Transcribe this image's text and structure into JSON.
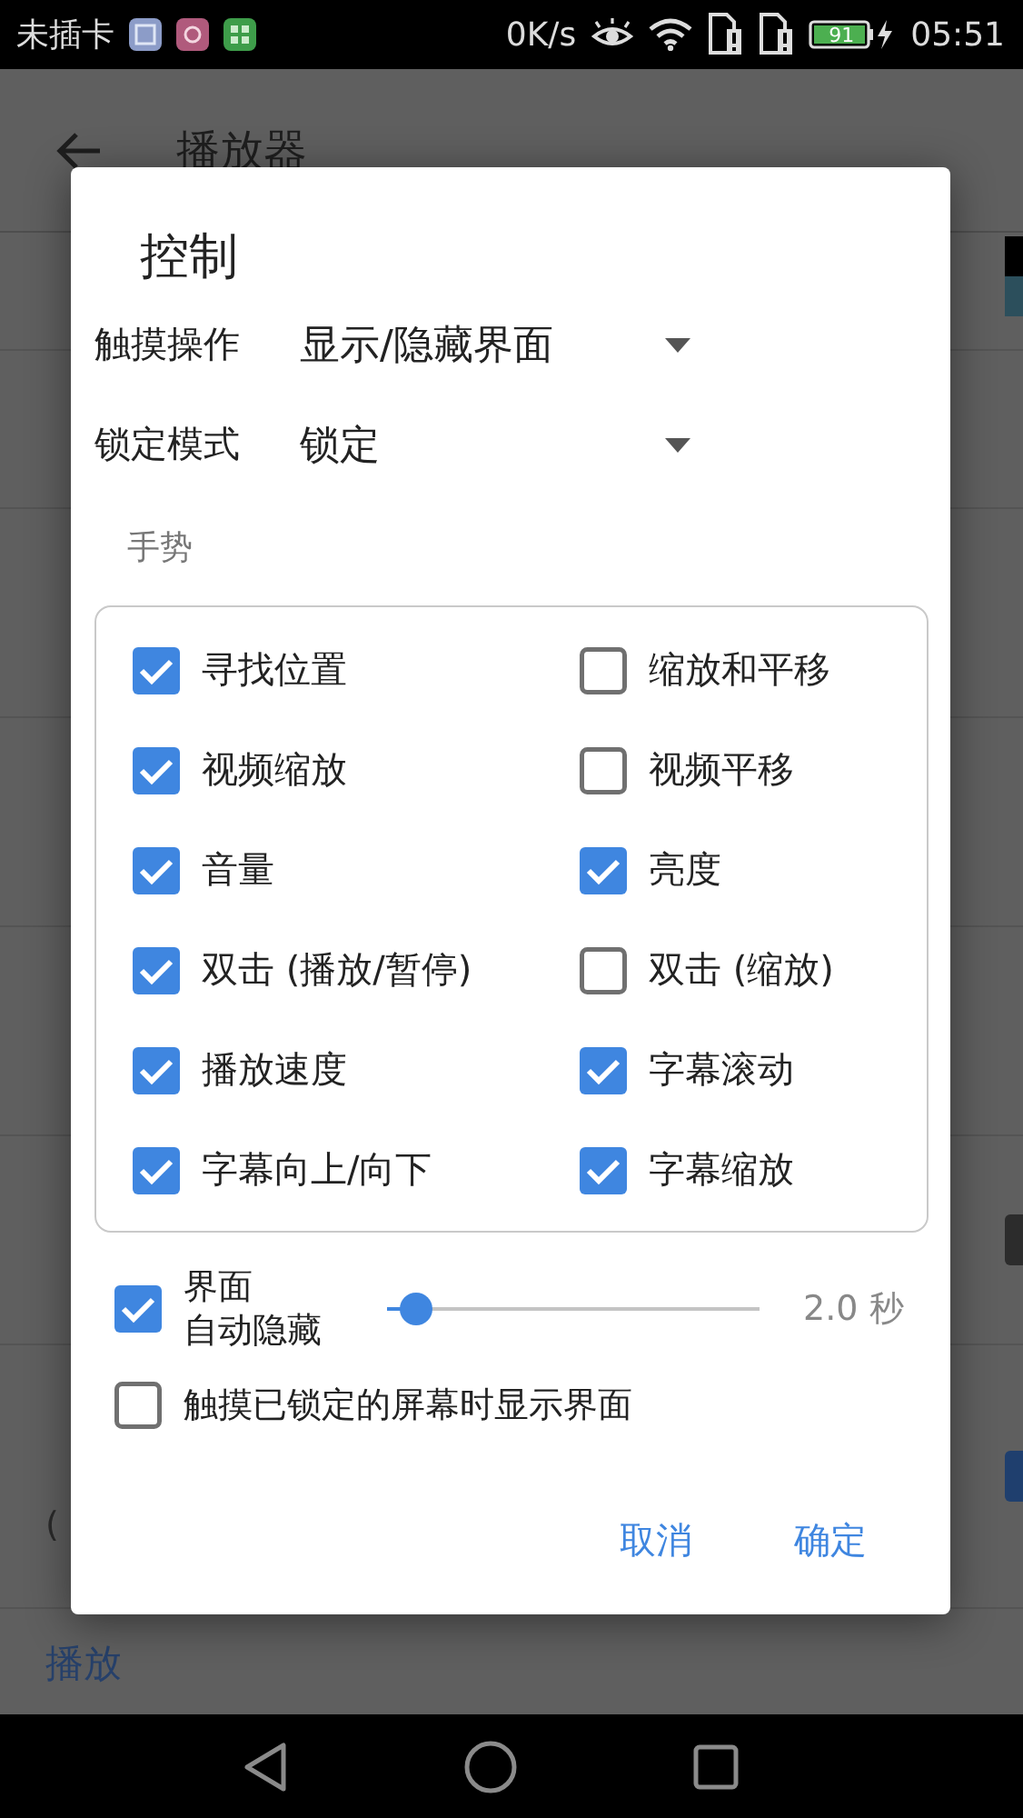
{
  "status_bar": {
    "carrier": "未插卡",
    "speed": "0K/s",
    "battery": "91",
    "time": "05:51"
  },
  "app_bar": {
    "title": "播放器"
  },
  "background_list": {
    "toggles": [
      {
        "on": false
      },
      {
        "on": true
      }
    ],
    "summary_fragment": "(",
    "section_header": "播放"
  },
  "dialog": {
    "title": "控制",
    "settings": [
      {
        "label": "触摸操作",
        "value": "显示/隐藏界面"
      },
      {
        "label": "锁定模式",
        "value": "锁定"
      }
    ],
    "section_label": "手势",
    "gestures": [
      {
        "label": "寻找位置",
        "checked": true
      },
      {
        "label": "缩放和平移",
        "checked": false
      },
      {
        "label": "视频缩放",
        "checked": true
      },
      {
        "label": "视频平移",
        "checked": false
      },
      {
        "label": "音量",
        "checked": true
      },
      {
        "label": "亮度",
        "checked": true
      },
      {
        "label": "双击 (播放/暂停)",
        "checked": true
      },
      {
        "label": "双击 (缩放)",
        "checked": false
      },
      {
        "label": "播放速度",
        "checked": true
      },
      {
        "label": "字幕滚动",
        "checked": true
      },
      {
        "label": "字幕向上/向下",
        "checked": true
      },
      {
        "label": "字幕缩放",
        "checked": true
      }
    ],
    "auto_hide": {
      "label_lines": [
        "界面",
        "自动隐藏"
      ],
      "checked": true,
      "level": 0.08,
      "reading": "2.0 秒"
    },
    "show_when_locked": {
      "label": "触摸已锁定的屏幕时显示界面",
      "checked": false
    },
    "buttons": [
      "取消",
      "确定"
    ]
  }
}
